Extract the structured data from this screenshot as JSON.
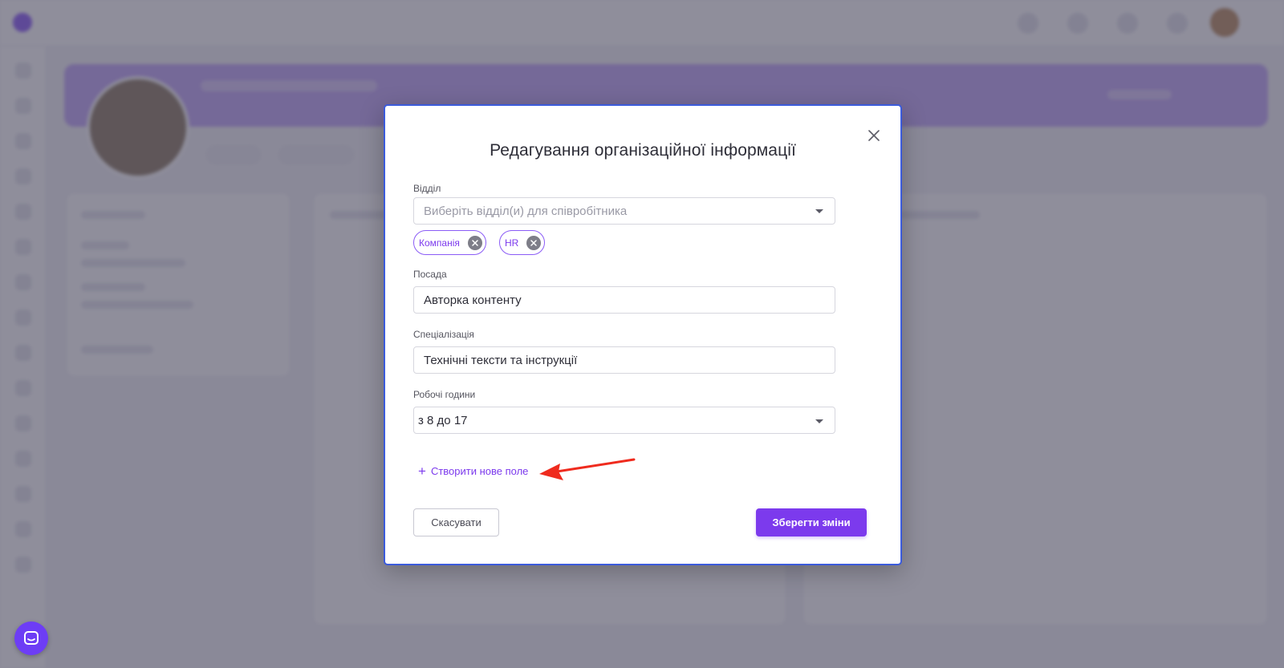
{
  "modal": {
    "title": "Редагування організаційної інформації",
    "department": {
      "label": "Відділ",
      "placeholder": "Виберіть відділ(и) для співробітника",
      "tags": [
        "Компанія",
        "HR"
      ]
    },
    "position": {
      "label": "Посада",
      "value": "Авторка контенту"
    },
    "specialization": {
      "label": "Спеціалізація",
      "value": "Технічні тексти та інструкції"
    },
    "work_hours": {
      "label": "Робочі години",
      "value": "з 8 до 17"
    },
    "create_field_label": "Створити нове поле",
    "cancel_label": "Скасувати",
    "save_label": "Зберегти зміни"
  },
  "colors": {
    "accent": "#7c3aed",
    "modal_border": "#3b5bdb",
    "annotation_arrow": "#ef2b1e"
  },
  "icons": {
    "close": "close-icon",
    "tag_remove": "remove-circle-icon",
    "dropdown": "caret-down-icon",
    "plus": "plus-icon",
    "chat": "chat-icon",
    "annotation": "red-arrow-icon"
  }
}
